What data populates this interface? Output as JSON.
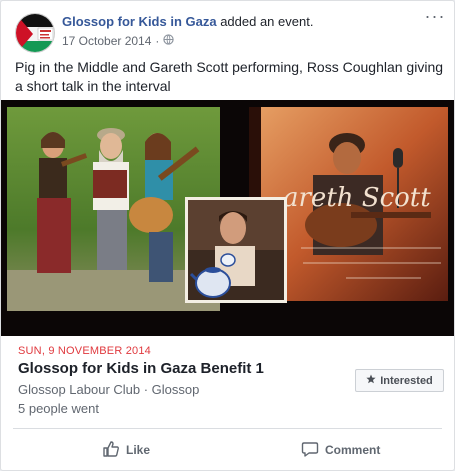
{
  "post": {
    "page_name": "Glossop for Kids in Gaza",
    "action": " added an event.",
    "date": "17 October 2014",
    "separator": "·",
    "privacy_icon": "globe-icon",
    "more_icon": "more-options-icon",
    "more_label": "···",
    "status": "Pig in the Middle and Gareth Scott performing, Ross Coughlan giving a short talk in the interval",
    "cover_text": "areth Scott"
  },
  "event": {
    "date": "SUN, 9 NOVEMBER 2014",
    "title": "Glossop for Kids in Gaza Benefit 1",
    "place": "Glossop Labour Club · Glossop",
    "went": "5 people went",
    "interested_label": "Interested",
    "interested_icon": "star-icon"
  },
  "actions": {
    "like_label": "Like",
    "comment_label": "Comment"
  },
  "colors": {
    "link": "#365899",
    "date_red": "#e0393e",
    "muted": "#616770"
  }
}
